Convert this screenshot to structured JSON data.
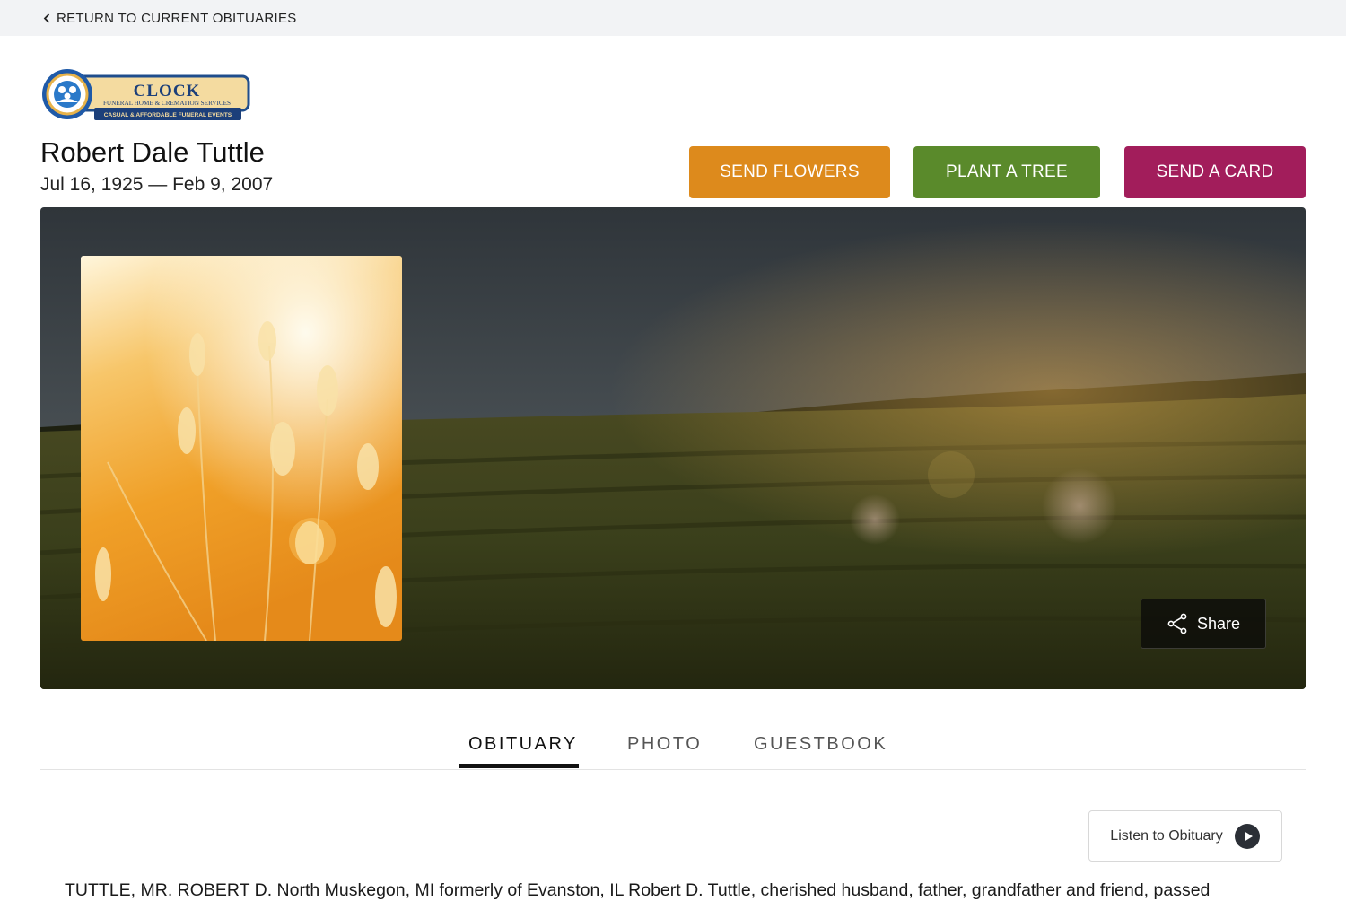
{
  "topbar": {
    "back_label": "RETURN TO CURRENT OBITUARIES"
  },
  "logo": {
    "brand": "CLOCK",
    "tagline": "FUNERAL HOME & CREMATION SERVICES",
    "banner": "CASUAL & AFFORDABLE FUNERAL EVENTS"
  },
  "person": {
    "name": "Robert Dale Tuttle",
    "dates": "Jul 16, 1925 — Feb 9, 2007"
  },
  "actions": {
    "flowers_label": "SEND FLOWERS",
    "tree_label": "PLANT A TREE",
    "card_label": "SEND A CARD",
    "flowers_color": "#dd8a1c",
    "tree_color": "#5a8a2b",
    "card_color": "#a21d5b"
  },
  "hero": {
    "share_label": "Share"
  },
  "tabs": [
    {
      "label": "OBITUARY",
      "active": true
    },
    {
      "label": "PHOTO",
      "active": false
    },
    {
      "label": "GUESTBOOK",
      "active": false
    }
  ],
  "listen": {
    "label": "Listen to Obituary"
  },
  "obituary": {
    "text": "TUTTLE, MR. ROBERT D. North Muskegon, MI formerly of Evanston, IL Robert D. Tuttle, cherished husband, father, grandfather and friend, passed"
  }
}
